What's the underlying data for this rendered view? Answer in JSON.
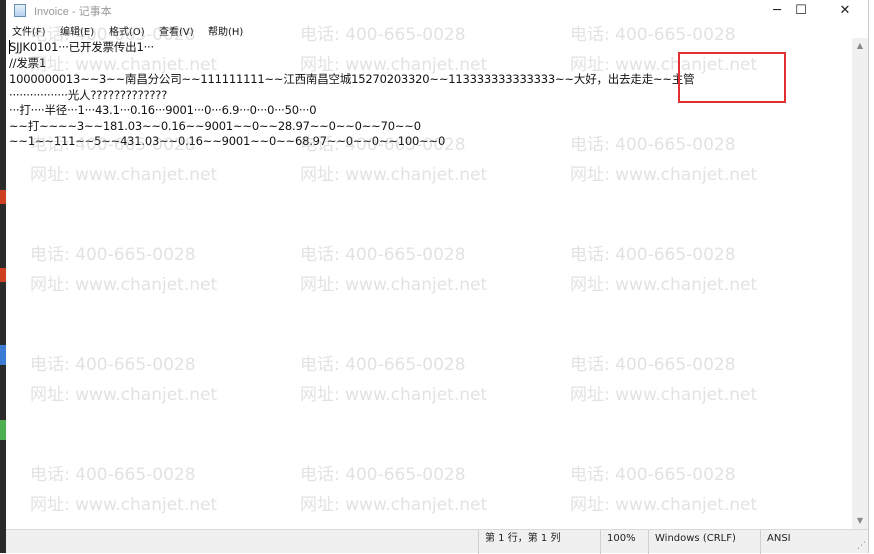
{
  "window": {
    "title": "Invoice - 记事本",
    "minimize_glyph": "─",
    "maximize_glyph": "☐",
    "close_glyph": "✕"
  },
  "menu": [
    {
      "label": "文件(F)"
    },
    {
      "label": "编辑(E)"
    },
    {
      "label": "格式(O)"
    },
    {
      "label": "查看(V)"
    },
    {
      "label": "帮助(H)"
    }
  ],
  "content_lines": [
    "SJJK0101···已开发票传出1···",
    "//发票1",
    "1000000013~~3~~南昌分公司~~111111111~~江西南昌空城15270203320~~113333333333333~~大好，出去走走~~主管",
    "·················光人?????????????",
    "···打····半径···1···43.1···0.16···9001···0···6.9···0···0···50···0",
    "~~打~~~~3~~181.03~~0.16~~9001~~0~~28.97~~0~~0~~70~~0",
    "~~1~~111~~5~~431.03~~0.16~~9001~~0~~68.97~~0~~0~~100~~0"
  ],
  "watermark": {
    "phone": "电话: 400-665-0028",
    "url": "网址: www.chanjet.net"
  },
  "statusbar": {
    "position": "第 1 行，第 1 列",
    "zoom": "100%",
    "line_ending": "Windows (CRLF)",
    "encoding": "ANSI"
  },
  "colors": {
    "highlight": "#e03030",
    "watermark": "#969696"
  }
}
